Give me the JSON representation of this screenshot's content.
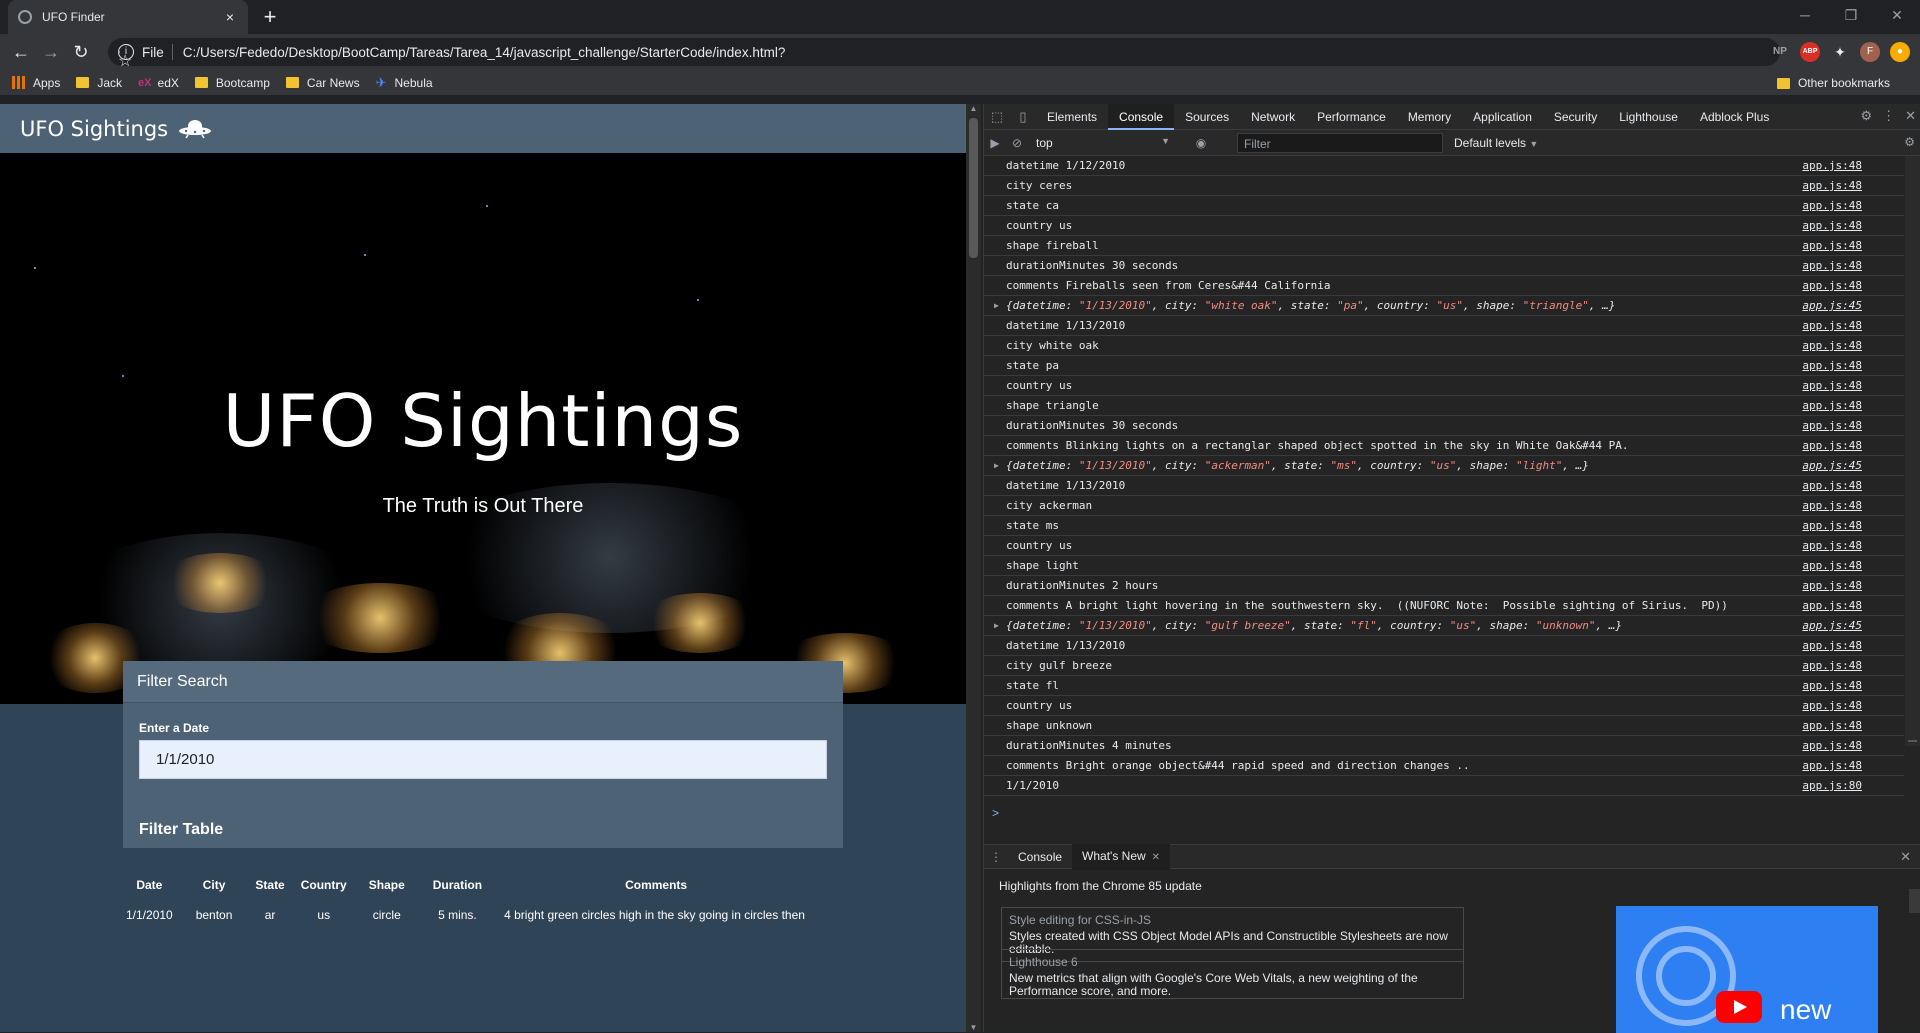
{
  "browser": {
    "tab_title": "UFO Finder",
    "tab_close": "×",
    "new_tab": "+",
    "url_scheme": "File",
    "url": "C:/Users/Fededo/Desktop/BootCamp/Tareas/Tarea_14/javascript_challenge/StarterCode/index.html?",
    "extensions": [
      "NP",
      "ABP",
      "F"
    ],
    "bookmarks": [
      "Apps",
      "Jack",
      "edX",
      "Bootcamp",
      "Car News",
      "Nebula"
    ],
    "other_bookmarks": "Other bookmarks"
  },
  "page": {
    "brand": "UFO Sightings",
    "hero_title": "UFO Sightings",
    "hero_subtitle": "The Truth is Out There",
    "filter_heading": "Filter Search",
    "date_label": "Enter a Date",
    "date_value": "1/1/2010",
    "filter_table_heading": "Filter Table",
    "table": {
      "headers": [
        "Date",
        "City",
        "State",
        "Country",
        "Shape",
        "Duration",
        "Comments"
      ],
      "rows": [
        [
          "1/1/2010",
          "benton",
          "ar",
          "us",
          "circle",
          "5 mins.",
          "4 bright green circles high in the sky going in circles then"
        ]
      ]
    }
  },
  "devtools": {
    "tabs": [
      "Elements",
      "Console",
      "Sources",
      "Network",
      "Performance",
      "Memory",
      "Application",
      "Security",
      "Lighthouse",
      "Adblock Plus"
    ],
    "active_tab": "Console",
    "context": "top",
    "filter_placeholder": "Filter",
    "levels": "Default levels",
    "console_rows": [
      {
        "text": "datetime 1/12/2010",
        "src": "app.js:48"
      },
      {
        "text": "city ceres",
        "src": "app.js:48"
      },
      {
        "text": "state ca",
        "src": "app.js:48"
      },
      {
        "text": "country us",
        "src": "app.js:48"
      },
      {
        "text": "shape fireball",
        "src": "app.js:48"
      },
      {
        "text": "durationMinutes 30 seconds",
        "src": "app.js:48"
      },
      {
        "text": "comments Fireballs seen from Ceres&#44 California",
        "src": "app.js:48"
      },
      {
        "text": "{datetime: \"1/13/2010\", city: \"white oak\", state: \"pa\", country: \"us\", shape: \"triangle\", …}",
        "src": "app.js:45",
        "obj": true
      },
      {
        "text": "datetime 1/13/2010",
        "src": "app.js:48"
      },
      {
        "text": "city white oak",
        "src": "app.js:48"
      },
      {
        "text": "state pa",
        "src": "app.js:48"
      },
      {
        "text": "country us",
        "src": "app.js:48"
      },
      {
        "text": "shape triangle",
        "src": "app.js:48"
      },
      {
        "text": "durationMinutes 30 seconds",
        "src": "app.js:48"
      },
      {
        "text": "comments Blinking lights on a rectanglar shaped object spotted in the sky in White Oak&#44 PA.",
        "src": "app.js:48"
      },
      {
        "text": "{datetime: \"1/13/2010\", city: \"ackerman\", state: \"ms\", country: \"us\", shape: \"light\", …}",
        "src": "app.js:45",
        "obj": true
      },
      {
        "text": "datetime 1/13/2010",
        "src": "app.js:48"
      },
      {
        "text": "city ackerman",
        "src": "app.js:48"
      },
      {
        "text": "state ms",
        "src": "app.js:48"
      },
      {
        "text": "country us",
        "src": "app.js:48"
      },
      {
        "text": "shape light",
        "src": "app.js:48"
      },
      {
        "text": "durationMinutes 2 hours",
        "src": "app.js:48"
      },
      {
        "text": "comments A bright light hovering in the southwestern sky.  ((NUFORC Note:  Possible sighting of Sirius.  PD))",
        "src": "app.js:48"
      },
      {
        "text": "{datetime: \"1/13/2010\", city: \"gulf breeze\", state: \"fl\", country: \"us\", shape: \"unknown\", …}",
        "src": "app.js:45",
        "obj": true
      },
      {
        "text": "datetime 1/13/2010",
        "src": "app.js:48"
      },
      {
        "text": "city gulf breeze",
        "src": "app.js:48"
      },
      {
        "text": "state fl",
        "src": "app.js:48"
      },
      {
        "text": "country us",
        "src": "app.js:48"
      },
      {
        "text": "shape unknown",
        "src": "app.js:48"
      },
      {
        "text": "durationMinutes 4 minutes",
        "src": "app.js:48"
      },
      {
        "text": "comments Bright orange object&#44 rapid speed and direction changes ..",
        "src": "app.js:48"
      },
      {
        "text": "1/1/2010",
        "src": "app.js:80"
      }
    ],
    "prompt": ">",
    "drawer": {
      "tabs": [
        "Console",
        "What's New"
      ],
      "active": "What's New",
      "highlights": "Highlights from the Chrome 85 update",
      "cards": [
        {
          "title": "Style editing for CSS-in-JS",
          "desc": "Styles created with CSS Object Model APIs and Constructible Stylesheets are now editable."
        },
        {
          "title": "Lighthouse 6",
          "desc": "New metrics that align with Google's Core Web Vitals, a new weighting of the Performance score, and more."
        }
      ],
      "promo_text": "new"
    }
  }
}
